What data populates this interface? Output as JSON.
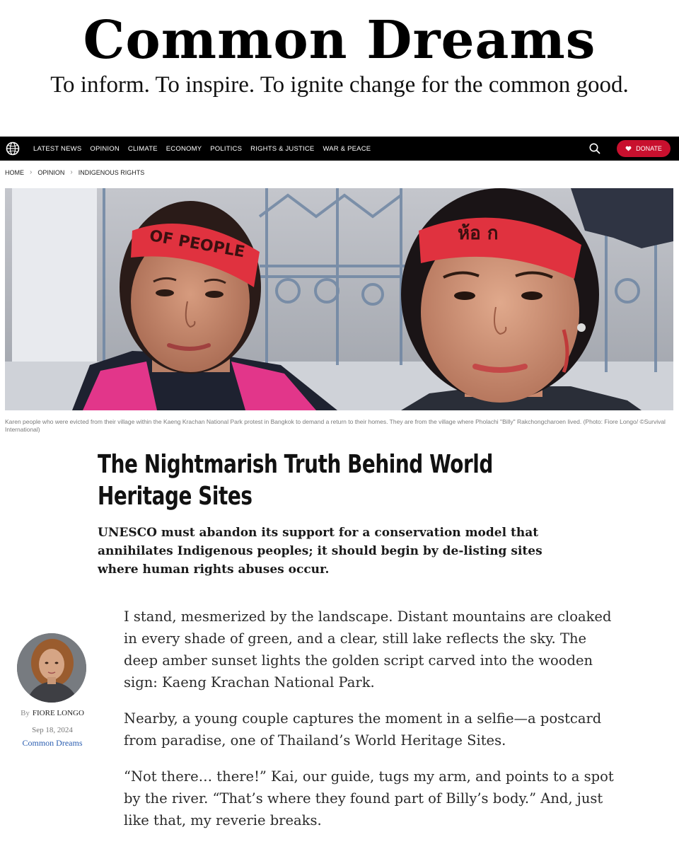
{
  "masthead": {
    "title": "Common Dreams",
    "tagline": "To inform. To inspire. To ignite change for the common good."
  },
  "nav": {
    "links": [
      "LATEST NEWS",
      "OPINION",
      "CLIMATE",
      "ECONOMY",
      "POLITICS",
      "RIGHTS & JUSTICE",
      "WAR & PEACE"
    ],
    "donate_label": "DONATE",
    "logo_icon": "globe-icon",
    "search_icon": "search-icon",
    "colors": {
      "bar": "#000000",
      "donate": "#c8102e"
    }
  },
  "breadcrumb": [
    "HOME",
    "OPINION",
    "INDIGENOUS RIGHTS"
  ],
  "hero": {
    "headband_left_text": "OF PEOPLE",
    "headband_right_text": "ห้อ ก",
    "caption": "Karen people who were evicted from their village within the Kaeng Krachan National Park protest in Bangkok to demand a return to their homes. They are from the village where Pholachi \"Billy\" Rakchongcharoen lived. (Photo: Fiore Longo/ ©Survival International)"
  },
  "article": {
    "headline": "The Nightmarish Truth Behind World Heritage Sites",
    "dek": "UNESCO must abandon its support for a conservation model that annihilates Indigenous peoples; it should begin by de-listing sites where human rights abuses occur.",
    "paragraphs": [
      "I stand, mesmerized by the landscape. Distant mountains are cloaked in every shade of green, and a clear, still lake reflects the sky. The deep amber sunset lights the golden script carved into the wooden sign: Kaeng Krachan National Park.",
      "Nearby, a young couple captures the moment in a selfie—a postcard from paradise, one of Thailand’s World Heritage Sites.",
      "“Not there… there!” Kai, our guide, tugs my arm, and points to a spot by the river. “That’s where they found part of Billy’s body.” And, just like that, my reverie breaks."
    ]
  },
  "author": {
    "by": "By",
    "name": "FIORE LONGO",
    "date": "Sep 18, 2024",
    "publication": "Common Dreams"
  }
}
